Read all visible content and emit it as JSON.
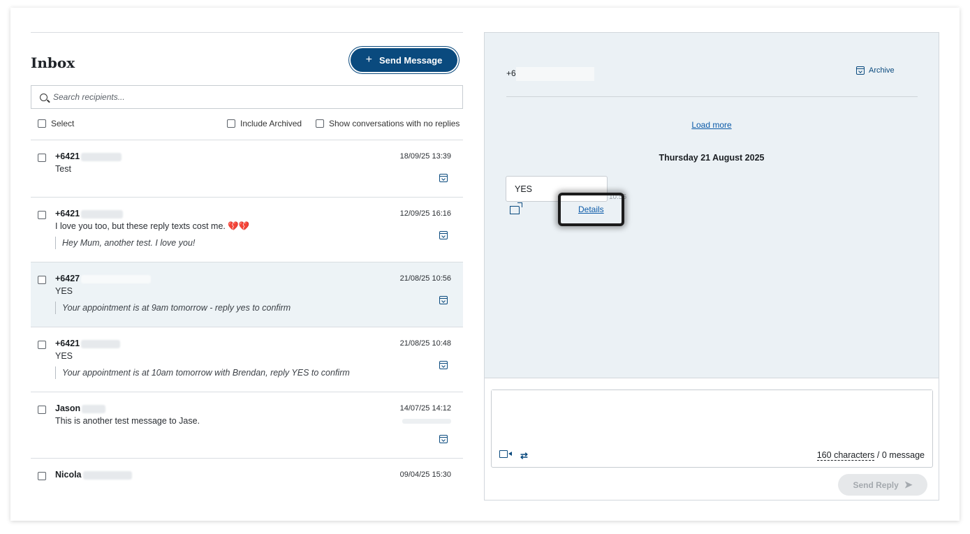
{
  "inbox": {
    "title": "Inbox",
    "send_message_label": "Send Message",
    "send_message_icon": "+",
    "search_placeholder": "Search recipients...",
    "select_label": "Select",
    "include_archived_label": "Include Archived",
    "show_no_replies_label": "Show conversations with no replies",
    "conversations": [
      {
        "name": "+6421",
        "message": "Test",
        "quote": "",
        "time": "18/09/25 13:39"
      },
      {
        "name": "+6421",
        "message": "I love you too, but these reply texts cost me. 💔💔",
        "quote": "Hey Mum, another test. I love you!",
        "time": "12/09/25 16:16"
      },
      {
        "name": "+6427",
        "message": "YES",
        "quote": "Your appointment is at 9am tomorrow - reply yes to confirm",
        "time": "21/08/25 10:56"
      },
      {
        "name": "+6421",
        "message": "YES",
        "quote": "Your appointment is at 10am tomorrow with Brendan, reply YES to confirm",
        "time": "21/08/25 10:48"
      },
      {
        "name": "Jason",
        "message": "This is another test message to Jase.",
        "quote": "",
        "time": "14/07/25 14:12"
      },
      {
        "name": "Nicola",
        "message": "",
        "quote": "",
        "time": "09/04/25 15:30"
      }
    ]
  },
  "thread": {
    "phone": "+6",
    "archive_label": "Archive",
    "load_more_label": "Load more",
    "date_heading": "Thursday 21 August 2025",
    "message_text": "YES",
    "message_time": "10:56",
    "details_label": "Details"
  },
  "composer": {
    "characters_label": "160 characters",
    "message_count_label": "/ 0 message",
    "send_reply_label": "Send Reply",
    "link_icon": "⇄"
  },
  "colors": {
    "primary": "#0a4a7e",
    "link": "#0a5aa8",
    "thread_bg": "#ebf1f5",
    "active_row_bg": "#edf3f6"
  }
}
